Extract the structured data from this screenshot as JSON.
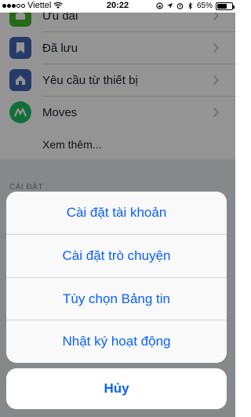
{
  "status_bar": {
    "carrier": "Viettel",
    "time": "20:22",
    "battery": "65%",
    "battery_level": 0.65
  },
  "menu": {
    "items": [
      {
        "label": "Ưu đãi",
        "icon": "offers-icon",
        "color": "#42b72a"
      },
      {
        "label": "Đã lưu",
        "icon": "bookmark-icon",
        "color": "#4267b2"
      },
      {
        "label": "Yêu cầu từ thiết bị",
        "icon": "device-request-icon",
        "color": "#4267b2"
      },
      {
        "label": "Moves",
        "icon": "moves-app-icon",
        "color": "#21c064"
      }
    ],
    "see_more": "Xem thêm...",
    "section_header": "CÀI ĐẶT"
  },
  "action_sheet": {
    "options": [
      "Cài đặt tài khoản",
      "Cài đặt trò chuyện",
      "Tùy chọn Bảng tin",
      "Nhật ký hoạt động"
    ],
    "cancel": "Hủy",
    "accent_color": "#0a60ff"
  }
}
